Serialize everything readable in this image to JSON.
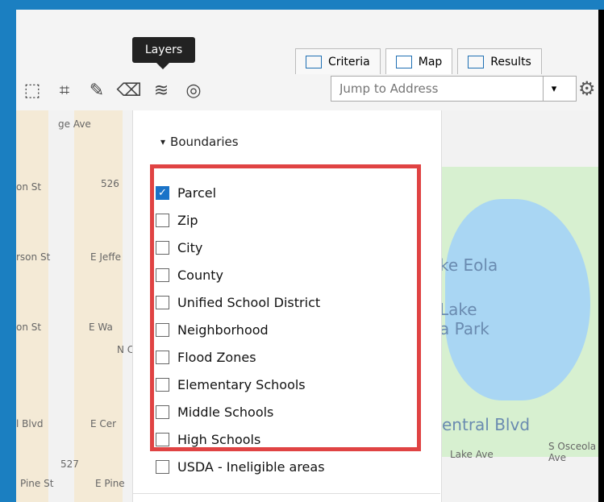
{
  "tooltip": {
    "text": "Layers"
  },
  "tabs": [
    {
      "label": "Criteria",
      "icon": "sliders-icon"
    },
    {
      "label": "Map",
      "icon": "map-icon"
    },
    {
      "label": "Results",
      "icon": "table-icon"
    }
  ],
  "jump": {
    "placeholder": "Jump to Address"
  },
  "panel": {
    "section_title": "Boundaries",
    "items": [
      {
        "label": "Parcel",
        "checked": true
      },
      {
        "label": "Zip",
        "checked": false
      },
      {
        "label": "City",
        "checked": false
      },
      {
        "label": "County",
        "checked": false
      },
      {
        "label": "Unified School District",
        "checked": false
      },
      {
        "label": "Neighborhood",
        "checked": false
      },
      {
        "label": "Flood Zones",
        "checked": false
      },
      {
        "label": "Elementary Schools",
        "checked": false
      },
      {
        "label": "Middle Schools",
        "checked": false
      },
      {
        "label": "High Schools",
        "checked": false
      },
      {
        "label": "USDA - Ineligible areas",
        "checked": false
      }
    ]
  },
  "map_labels": {
    "ave": "ge Ave",
    "on_st": "on St",
    "badge526": "526",
    "rson_st": "rson St",
    "jeffe": "E Jeffe",
    "on_st2": "on St",
    "wa": "E Wa",
    "court": "N Court Ave",
    "blvd": "l Blvd",
    "cer": "E Cer",
    "badge527": "527",
    "pine": "Pine St",
    "epine": "E Pine",
    "lake_eola": "ke Eola",
    "lake_park": "Lake\na Park",
    "central": "entral Blvd",
    "lake_ave": "Lake Ave",
    "osceola": "S Osceola Ave"
  }
}
